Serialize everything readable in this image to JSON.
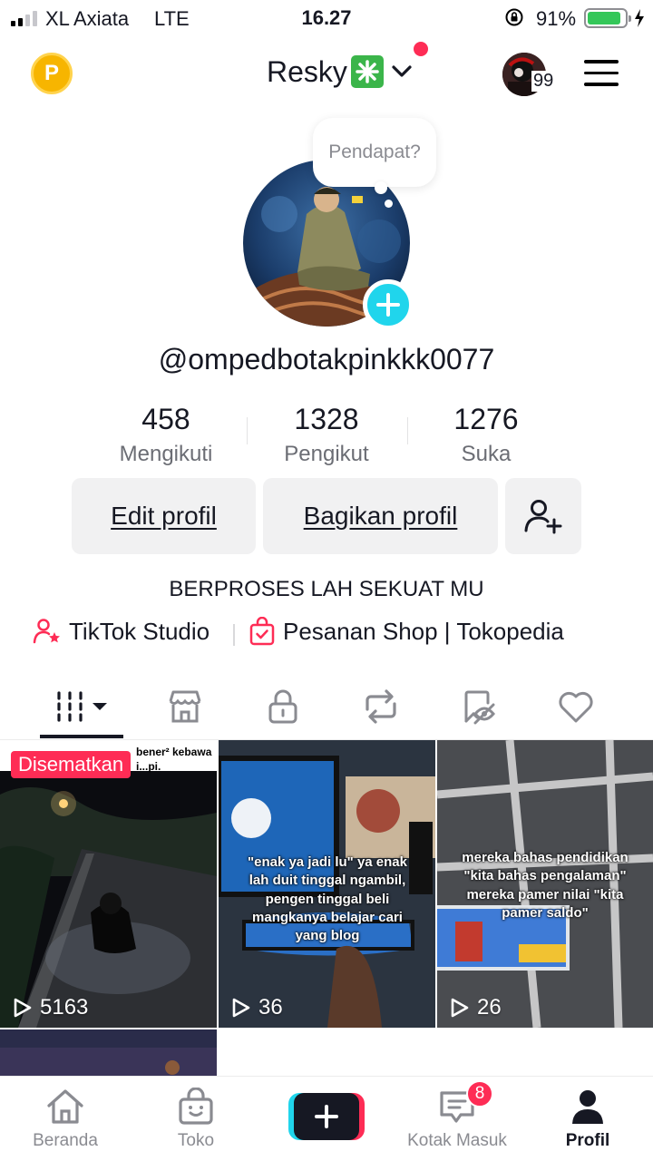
{
  "status_bar": {
    "carrier": "XL Axiata",
    "network": "LTE",
    "time": "16.27",
    "battery_percent": "91%",
    "battery_level": 0.91
  },
  "header": {
    "username": "Resky",
    "story_count": "99",
    "has_notification_dot": true
  },
  "profile": {
    "bubble_text": "Pendapat?",
    "handle": "@ompedbotakpinkkk0077",
    "stats": [
      {
        "value": "458",
        "label": "Mengikuti"
      },
      {
        "value": "1328",
        "label": "Pengikut"
      },
      {
        "value": "1276",
        "label": "Suka"
      }
    ],
    "buttons": {
      "edit": "Edit profil",
      "share": "Bagikan profil"
    },
    "bio": "BERPROSES LAH SEKUAT MU",
    "links": [
      {
        "label": "TikTok Studio",
        "icon": "user-star-icon"
      },
      {
        "label": "Pesanan Shop | Tokopedia",
        "icon": "shopping-bag-icon"
      }
    ]
  },
  "tabs": [
    {
      "icon": "videos-grid-icon",
      "active": true
    },
    {
      "icon": "shop-icon",
      "active": false
    },
    {
      "icon": "lock-icon",
      "active": false
    },
    {
      "icon": "repost-icon",
      "active": false
    },
    {
      "icon": "favorites-icon",
      "active": false
    },
    {
      "icon": "heart-icon",
      "active": false
    }
  ],
  "videos": [
    {
      "views": "5163",
      "pinned_label": "Disematkan",
      "caption": "bener² kebawa i...pi."
    },
    {
      "views": "36",
      "caption": "\"enak ya jadi lu\" ya enak lah duit tinggal ngambil, pengen tinggal beli mangkanya belajar cari yang blog"
    },
    {
      "views": "26",
      "caption": "mereka bahas pendidikan \"kita bahas pengalaman\" mereka pamer nilai \"kita pamer saldo\""
    }
  ],
  "bottom_nav": {
    "items": [
      {
        "label": "Beranda",
        "icon": "home-icon"
      },
      {
        "label": "Toko",
        "icon": "shop-bag-icon"
      },
      {
        "label": "Kotak Masuk",
        "icon": "inbox-icon",
        "badge": "8"
      },
      {
        "label": "Profil",
        "icon": "profile-icon",
        "active": true
      }
    ]
  },
  "colors": {
    "accent_red": "#fe2c55",
    "accent_cyan": "#20d5ec",
    "text_primary": "#161823",
    "text_secondary": "#6b6d74",
    "button_bg": "#f1f1f2"
  }
}
